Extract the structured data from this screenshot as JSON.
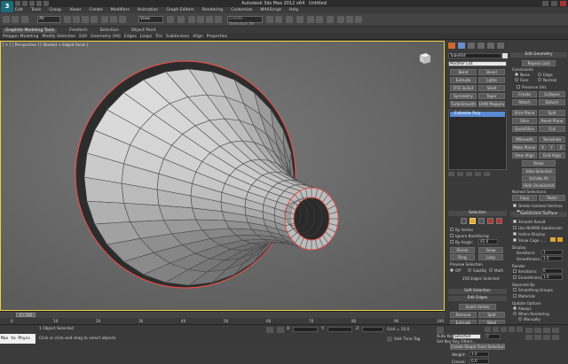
{
  "app": {
    "title": "Autodesk 3ds Max 2012 x64",
    "filename": "Untitled",
    "logo": "3"
  },
  "menu": [
    "Edit",
    "Tools",
    "Group",
    "Views",
    "Create",
    "Modifiers",
    "Animation",
    "Graph Editors",
    "Rendering",
    "Customize",
    "MAXScript",
    "Help"
  ],
  "toolbar": {
    "selection_filter": "All",
    "ref_coord": "View",
    "selection_set": "Create Selection Se"
  },
  "ribbon": {
    "tabs": [
      "Graphite Modeling Tools",
      "Freeform",
      "Selection",
      "Object Paint"
    ],
    "tools": [
      "Polygon Modeling",
      "Modify Selection",
      "Edit",
      "Geometry (All)",
      "Edges",
      "Loops",
      "Tris",
      "Subdivision",
      "Align",
      "Properties"
    ]
  },
  "viewport": {
    "label": "[ + ] [ Perspective ] [ Shaded + Edged Faces ]"
  },
  "command_panel": {
    "object_name": "Tube004",
    "modifier_list": "Modifier List",
    "mod_buttons": [
      "Bend",
      "Bevel",
      "Extrude",
      "Lathe",
      "FFD 3x3x3",
      "Shell",
      "Symmetry",
      "Taper",
      "TurboSmooth",
      "UVW Mapping Cle"
    ],
    "stack_item": "Editable Poly",
    "selection": {
      "title": "Selection",
      "by_vertex": "By Vertex",
      "ignore_backfacing": "Ignore Backfacing",
      "by_angle": "By Angle:",
      "by_angle_value": "45.0",
      "shrink": "Shrink",
      "grow": "Grow",
      "ring": "Ring",
      "loop": "Loop",
      "preview": "Preview Selection",
      "off": "Off",
      "subobj": "SubObj",
      "multi": "Multi",
      "status": "256 Edges Selected"
    },
    "soft_selection": "Soft Selection",
    "edit_edges": {
      "title": "Edit Edges",
      "insert_vertex": "Insert Vertex",
      "remove": "Remove",
      "split": "Split",
      "extrude": "Extrude",
      "weld": "Weld",
      "chamfer": "Chamfer",
      "target_weld": "Target Weld",
      "bridge": "Bridge",
      "connect": "Connect",
      "create_shape": "Create Shape From Selection",
      "weight_label": "Weight:",
      "weight_value": "1.0",
      "crease_label": "Crease:",
      "crease_value": "0.0"
    }
  },
  "right_panel": {
    "edit_geometry": "Edit Geometry",
    "repeat_last": "Repeat Last",
    "constraints": "Constraints",
    "none": "None",
    "edge": "Edge",
    "face": "Face",
    "normal": "Normal",
    "preserve_uvs": "Preserve UVs",
    "create": "Create",
    "collapse": "Collapse",
    "attach": "Attach",
    "detach": "Detach",
    "slice_plane": "Slice Plane",
    "split": "Split",
    "slice": "Slice",
    "reset_plane": "Reset Plane",
    "quickslice": "QuickSlice",
    "cut": "Cut",
    "msmooth": "MSmooth",
    "tessellate": "Tessellate",
    "make_planar": "Make Planar",
    "x": "X",
    "y": "Y",
    "z": "Z",
    "view_align": "View Align",
    "grid_align": "Grid Align",
    "relax": "Relax",
    "hide_selected": "Hide Selected",
    "unhide_all": "Unhide All",
    "hide_unselected": "Hide Unselected",
    "named_selections": "Named Selections:",
    "copy": "Copy",
    "paste": "Paste",
    "delete_isolated": "Delete Isolated Vertices",
    "full_interactivity": "Full Interactivity",
    "subdivision_surface": "Subdivision Surface",
    "smooth_result": "Smooth Result",
    "use_nurms": "Use NURMS Subdivision",
    "isoline_display": "Isoline Display",
    "show_cage": "Show Cage......",
    "display": "Display",
    "iterations_label": "Iterations:",
    "iterations_value": "1",
    "smoothness_label": "Smoothness:",
    "smoothness_value": "1.0",
    "render": "Render",
    "iterations2_label": "Iterations:",
    "iterations2_value": "0",
    "smoothness2_label": "Smoothness:",
    "smoothness2_value": "1.0",
    "separate_by": "Separate By",
    "smoothing_groups": "Smoothing Groups",
    "materials": "Materials",
    "update_options": "Update Options",
    "always": "Always",
    "when_rendering": "When Rendering",
    "manually": "Manually"
  },
  "timeline": {
    "frame": "0 / 100",
    "ticks": [
      "0",
      "10",
      "20",
      "30",
      "40",
      "50",
      "60",
      "70",
      "80",
      "90",
      "100"
    ]
  },
  "status": {
    "maxscript": "Max to Physc",
    "objects_selected": "1 Object Selected",
    "prompt": "Click or click-and-drag to select objects",
    "x_label": "X:",
    "y_label": "Y:",
    "z_label": "Z:",
    "grid": "Grid = 10.0",
    "add_time_tag": "Add Time Tag",
    "auto_key": "Auto Key",
    "set_key": "Set Key",
    "key_filter": "Selected",
    "key_filters_btn": "Key Filters...",
    "frame": "0"
  },
  "colors": {
    "accent": "#d9a93a",
    "viewport_bg": "#6a6a6a",
    "mesh": "#4a4a4a",
    "selected_edges": "#e0504a"
  }
}
